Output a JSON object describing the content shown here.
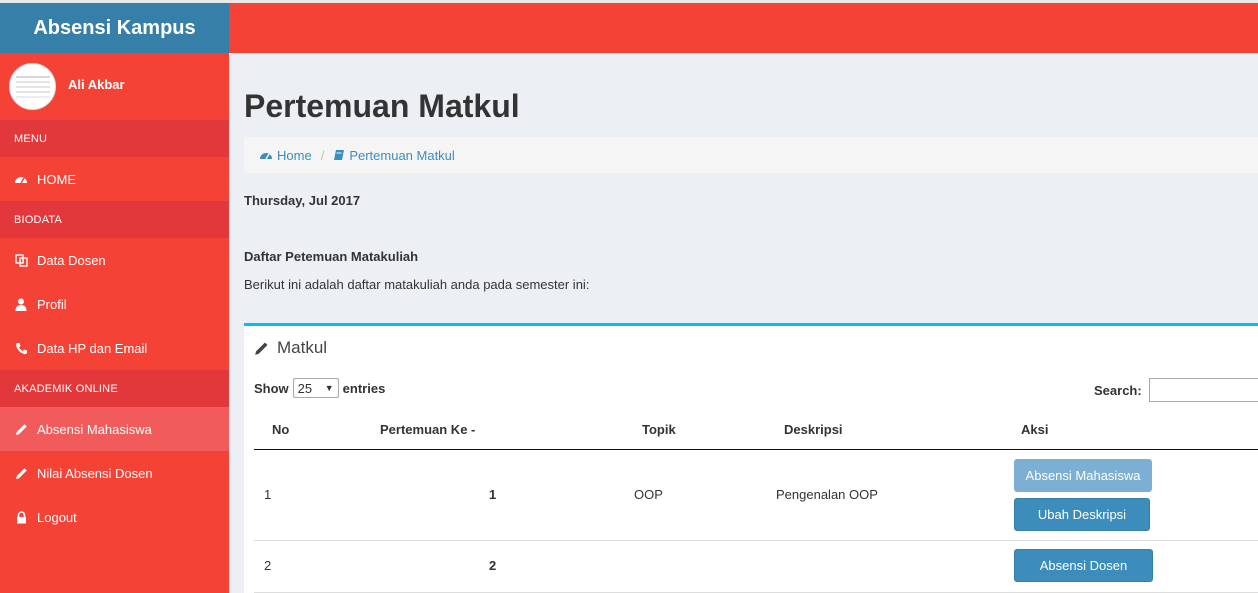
{
  "app": {
    "title": "Absensi Kampus"
  },
  "user": {
    "name": "Ali Akbar"
  },
  "sidebar": {
    "sections": [
      {
        "header": "MENU",
        "items": [
          {
            "label": "HOME",
            "icon": "dashboard-icon"
          }
        ]
      },
      {
        "header": "BIODATA",
        "items": [
          {
            "label": "Data Dosen",
            "icon": "copy-icon"
          },
          {
            "label": "Profil",
            "icon": "user-icon"
          },
          {
            "label": "Data HP dan Email",
            "icon": "phone-icon"
          }
        ]
      },
      {
        "header": "AKADEMIK ONLINE",
        "items": [
          {
            "label": "Absensi Mahasiswa",
            "icon": "pencil-icon",
            "active": true
          },
          {
            "label": "Nilai Absensi Dosen",
            "icon": "pencil-icon"
          },
          {
            "label": "Logout",
            "icon": "lock-icon"
          }
        ]
      }
    ]
  },
  "page": {
    "title": "Pertemuan Matkul",
    "breadcrumb": {
      "home": "Home",
      "current": "Pertemuan Matkul"
    },
    "date": "Thursday, Jul 2017",
    "list_title": "Daftar Petemuan Matakuliah",
    "list_desc": "Berikut ini adalah daftar matakuliah anda pada semester ini:"
  },
  "box": {
    "title": "Matkul",
    "show_label": "Show",
    "entries_value": "25",
    "entries_label": "entries",
    "search_label": "Search:",
    "search_value": ""
  },
  "table": {
    "headers": {
      "no": "No",
      "pertemuan": "Pertemuan Ke -",
      "topik": "Topik",
      "deskripsi": "Deskripsi",
      "aksi": "Aksi"
    },
    "rows": [
      {
        "no": "1",
        "pertemuan": "1",
        "topik": "OOP",
        "deskripsi": "Pengenalan OOP",
        "actions": [
          "Absensi Mahasiswa",
          "Ubah Deskripsi"
        ]
      },
      {
        "no": "2",
        "pertemuan": "2",
        "topik": "",
        "deskripsi": "",
        "actions": [
          "Absensi Dosen"
        ]
      }
    ]
  },
  "colors": {
    "sidebar": "#f44336",
    "logo": "#367fa9",
    "accent": "#3c8dbc",
    "box_top": "#00c0ef"
  }
}
